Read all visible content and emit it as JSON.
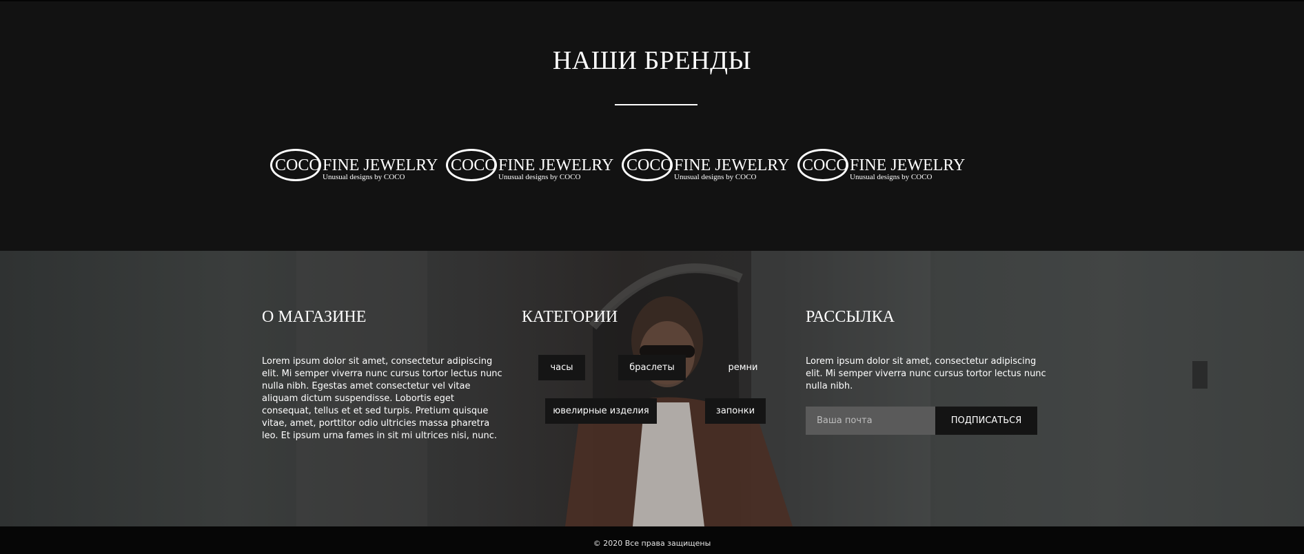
{
  "brands": {
    "title": "НАШИ БРЕНДЫ",
    "logos": [
      {
        "mark": "COCO",
        "name": "FINE JEWELRY",
        "tagline": "Unusual designs by COCO"
      },
      {
        "mark": "COCO",
        "name": "FINE JEWELRY",
        "tagline": "Unusual designs by COCO"
      },
      {
        "mark": "COCO",
        "name": "FINE JEWELRY",
        "tagline": "Unusual designs by COCO"
      },
      {
        "mark": "COCO",
        "name": "FINE JEWELRY",
        "tagline": "Unusual designs by COCO"
      }
    ]
  },
  "footer": {
    "about": {
      "title": "О МАГАЗИНЕ",
      "text": "Lorem ipsum dolor sit amet, consectetur adipiscing elit. Mi semper viverra nunc cursus tortor lectus nunc nulla nibh. Egestas amet consectetur vel vitae aliquam dictum suspendisse. Lobortis eget consequat, tellus et et sed turpis. Pretium quisque vitae, amet, porttitor odio ultricies massa pharetra leo. Et ipsum urna fames in sit mi ultrices nisi, nunc."
    },
    "categories": {
      "title": "КАТЕГОРИИ",
      "items": [
        "часы",
        "браслеты",
        "ремни",
        "ювелирные изделия",
        "запонки"
      ]
    },
    "newsletter": {
      "title": "РАССЫЛКА",
      "text": "Lorem ipsum dolor sit amet, consectetur adipiscing elit. Mi semper viverra nunc cursus tortor lectus nunc nulla nibh.",
      "email_placeholder": "Ваша почта",
      "email_value": "",
      "button_label": "ПОДПИСАТЬСЯ"
    }
  },
  "copyright": "© 2020 Все права защищены"
}
